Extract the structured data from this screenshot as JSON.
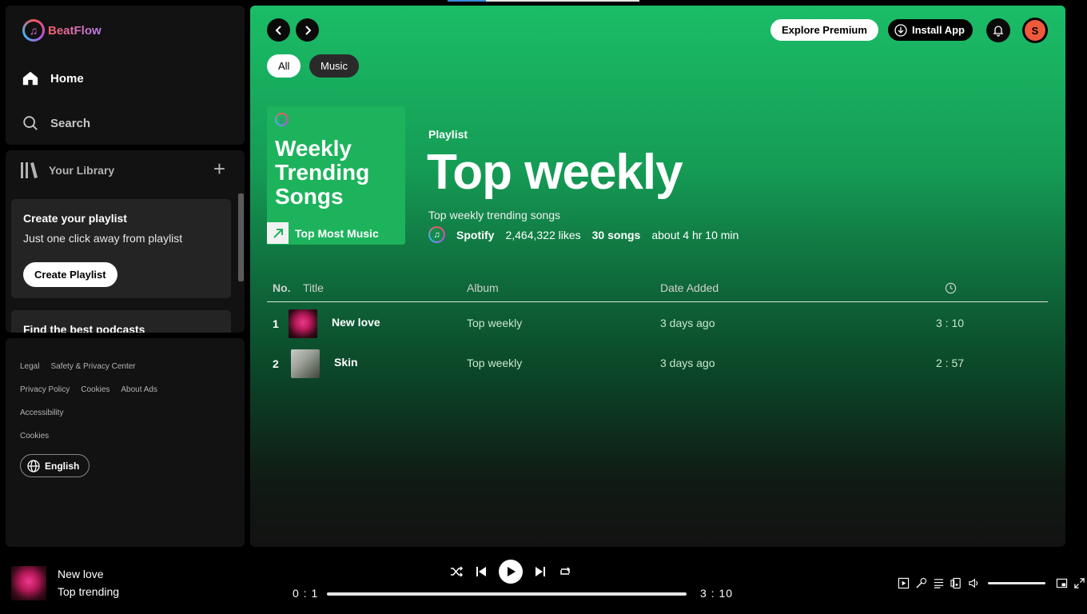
{
  "app": {
    "name": "BeatFlow"
  },
  "nav": {
    "home_label": "Home",
    "search_label": "Search"
  },
  "library": {
    "title": "Your Library",
    "cards": [
      {
        "title": "Create your playlist",
        "subtitle": "Just one click away from playlist",
        "button": "Create Playlist"
      },
      {
        "title": "Find the best podcasts"
      }
    ]
  },
  "footer": {
    "links": [
      "Legal",
      "Safety & Privacy Center",
      "Privacy Policy",
      "Cookies",
      "About Ads",
      "Accessibility",
      "Cookies"
    ],
    "language": "English"
  },
  "header": {
    "explore_premium": "Explore Premium",
    "install_app": "Install App",
    "avatar_initial": "S"
  },
  "filters": [
    "All",
    "Music"
  ],
  "playlist": {
    "cover_title": "Weekly Trending Songs",
    "cover_subtitle": "Top Most Music",
    "label": "Playlist",
    "title": "Top weekly",
    "description": "Top weekly trending songs",
    "owner": "Spotify",
    "likes": "2,464,322 likes",
    "song_count": "30 songs",
    "duration": "about 4 hr 10 min"
  },
  "table": {
    "columns": {
      "no": "No.",
      "title": "Title",
      "album": "Album",
      "date": "Date Added",
      "duration_icon": "clock-icon"
    },
    "rows": [
      {
        "no": "1",
        "title": "New love",
        "album": "Top weekly",
        "date": "3 days ago",
        "duration": "3 : 10"
      },
      {
        "no": "2",
        "title": "Skin",
        "album": "Top weekly",
        "date": "3 days ago",
        "duration": "2 : 57"
      }
    ]
  },
  "player": {
    "track_title": "New love",
    "track_artist": "Top trending",
    "current_time": "0 : 1",
    "total_time": "3 : 10",
    "progress_fraction": 0
  },
  "colors": {
    "accent_green": "#1bbd67",
    "panel_bg": "#121212",
    "avatar_bg": "#ef5a3a"
  }
}
